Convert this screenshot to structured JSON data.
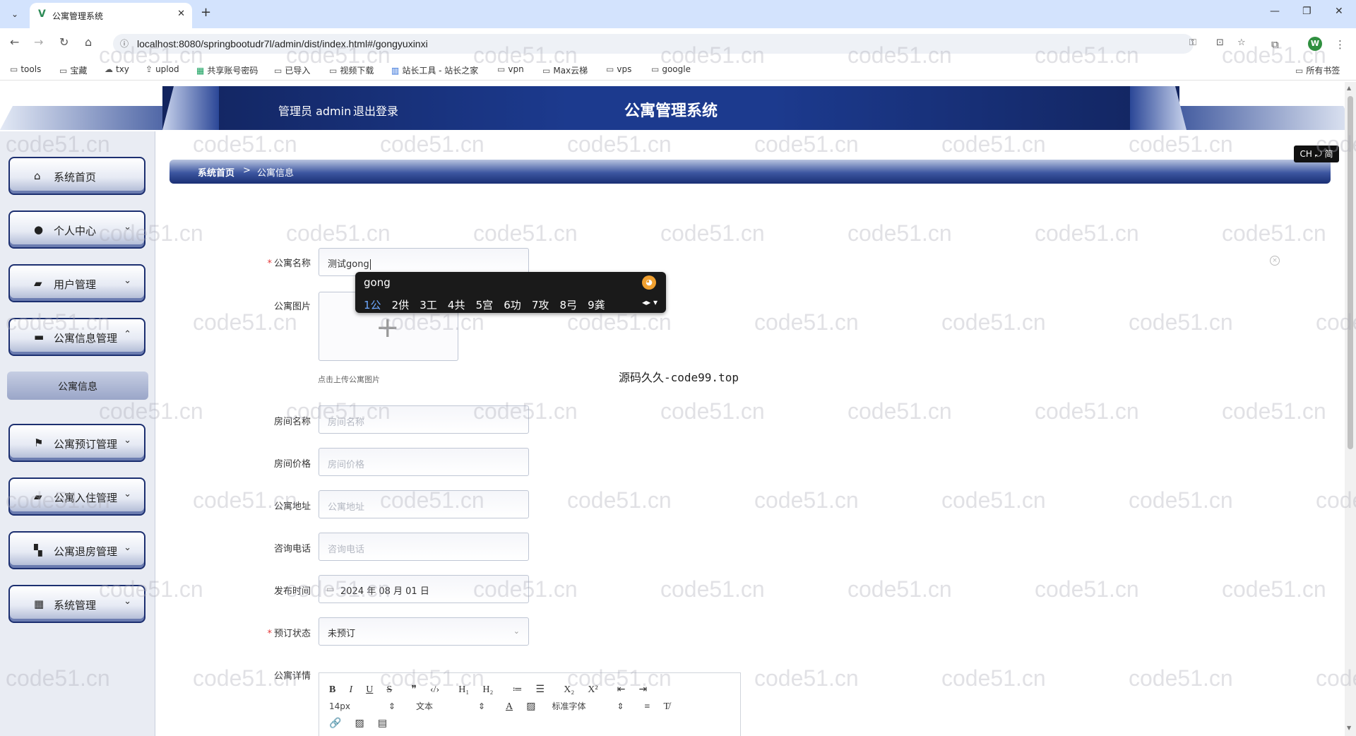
{
  "browser": {
    "tab_title": "公寓管理系统",
    "url": "localhost:8080/springbootudr7l/admin/dist/index.html#/gongyuxinxi",
    "profile_initial": "W",
    "bookmarks": [
      "tools",
      "宝藏",
      "txy",
      "uplod",
      "共享账号密码",
      "已导入",
      "视频下载",
      "站长工具 - 站长之家",
      "vpn",
      "Max云梯",
      "vps",
      "google"
    ],
    "all_bookmarks": "所有书签"
  },
  "header": {
    "user_label": "管理员 admin",
    "logout_label": "退出登录",
    "title": "公寓管理系统"
  },
  "sidebar": {
    "items": [
      {
        "label": "系统首页",
        "icon": "home-icon"
      },
      {
        "label": "个人中心",
        "icon": "user-icon"
      },
      {
        "label": "用户管理",
        "icon": "users-icon"
      },
      {
        "label": "公寓信息管理",
        "icon": "monitor-icon"
      },
      {
        "label": "公寓预订管理",
        "icon": "flag-icon"
      },
      {
        "label": "公寓入住管理",
        "icon": "building-icon"
      },
      {
        "label": "公寓退房管理",
        "icon": "grid-icon"
      },
      {
        "label": "系统管理",
        "icon": "apps-icon"
      }
    ],
    "sub_item": "公寓信息"
  },
  "breadcrumb": {
    "home": "系统首页",
    "separator": ">",
    "current": "公寓信息"
  },
  "ime_indicator": "CH ⤾ 简",
  "form": {
    "name": {
      "label": "公寓名称",
      "value": "测试gong"
    },
    "image": {
      "label": "公寓图片",
      "hint": "点击上传公寓图片"
    },
    "room_name": {
      "label": "房间名称",
      "placeholder": "房间名称"
    },
    "room_price": {
      "label": "房间价格",
      "placeholder": "房间价格"
    },
    "address": {
      "label": "公寓地址",
      "placeholder": "公寓地址"
    },
    "phone": {
      "label": "咨询电话",
      "placeholder": "咨询电话"
    },
    "publish_time": {
      "label": "发布时间",
      "value": "2024 年 08 月 01 日"
    },
    "status": {
      "label": "预订状态",
      "value": "未预订"
    },
    "detail": {
      "label": "公寓详情"
    }
  },
  "ime_popup": {
    "composition": "gong",
    "candidates": [
      "1公",
      "2供",
      "3工",
      "4共",
      "5宫",
      "6功",
      "7攻",
      "8弓",
      "9龚"
    ]
  },
  "editor": {
    "row1": [
      "B",
      "I",
      "U",
      "S",
      "❞",
      "‹/›",
      "H₁",
      "H₂",
      "≔",
      "☰",
      "X₂",
      "X²",
      "⇤",
      "⇥"
    ],
    "font_size": "14px",
    "block_type": "文本",
    "font_family": "标准字体",
    "row3": [
      "🔗",
      "▨",
      "▤"
    ]
  },
  "caption": "源码久久-code99.top",
  "watermark": "code51.cn",
  "colors": {
    "header_navy": "#1c3a8e",
    "sidebar_border": "#1c2f70",
    "required": "#e53b3b",
    "browser_tabstrip": "#d3e3fd"
  }
}
